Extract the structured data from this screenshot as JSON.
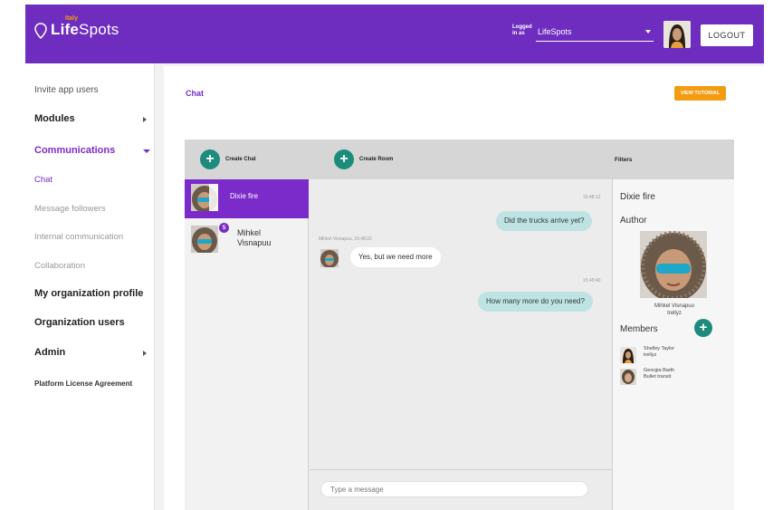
{
  "header": {
    "logo_small": "Italy",
    "logo_part1": "Life",
    "logo_part2": "Spots",
    "logged_in_line1": "Logged",
    "logged_in_line2": "in as",
    "account": "LifeSpots",
    "logout_label": "LOGOUT"
  },
  "sidebar": {
    "items": [
      {
        "label": "Invite app users"
      },
      {
        "label": "Modules"
      },
      {
        "label": "Communications"
      },
      {
        "label": "Chat"
      },
      {
        "label": "Message followers"
      },
      {
        "label": "Internal communication"
      },
      {
        "label": "Collaboration"
      },
      {
        "label": "My organization profile"
      },
      {
        "label": "Organization users"
      },
      {
        "label": "Admin"
      },
      {
        "label": "Platform License Agreement"
      }
    ]
  },
  "page": {
    "title": "Chat",
    "tutorial_label": "VIEW TUTORIAL"
  },
  "toolbar": {
    "create_chat": "Create Chat",
    "create_room": "Create Room",
    "filters": "Filters",
    "plus": "+"
  },
  "conversations": [
    {
      "name": "Dixie fire",
      "active": true
    },
    {
      "name": "Mihkel Visnapuu",
      "badge": "5"
    }
  ],
  "messages": {
    "ts1": "15:48:12",
    "m1": "Did the trucks arrive yet?",
    "sender2": "Mihkel Visnapuu, 15:48:22",
    "m2": "Yes, but we need more",
    "ts3": "15:49:40",
    "m3": "How many more do you need?"
  },
  "compose": {
    "placeholder": "Type a message"
  },
  "details": {
    "room_name": "Dixie fire",
    "author_label": "Author",
    "author_name": "Mihkel Visnapuu",
    "author_org": "trellyz",
    "members_label": "Members",
    "members": [
      {
        "name": "Shelley Taylor",
        "org": "trellyz"
      },
      {
        "name": "Georgia Barth",
        "org": "Bullet transit"
      }
    ]
  },
  "colors": {
    "brand_purple": "#6e2dbf",
    "accent_teal": "#1d8c7c",
    "tutorial_orange": "#f39c12",
    "bubble_out": "#bfe3e3"
  }
}
